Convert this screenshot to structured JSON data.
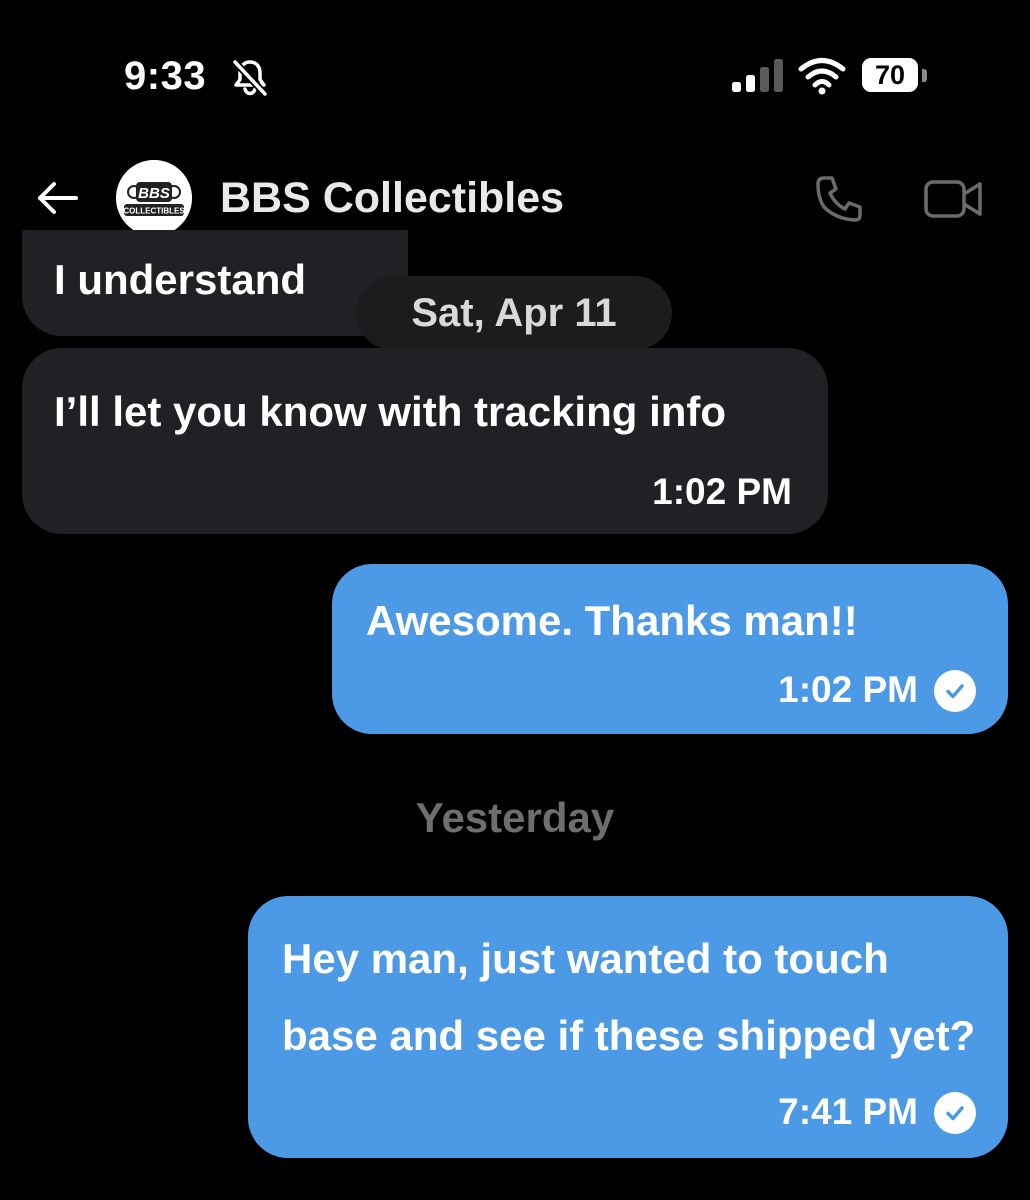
{
  "status_bar": {
    "time": "9:33",
    "battery": "70",
    "icons": [
      "bell-slash-icon",
      "signal-icon",
      "wifi-icon",
      "battery-icon"
    ]
  },
  "header": {
    "contact_name": "BBS Collectibles",
    "avatar": {
      "line1": "BBS",
      "line2": "COLLECTIBLES"
    },
    "icons": [
      "back-arrow-icon",
      "phone-icon",
      "video-icon"
    ]
  },
  "messages": [
    {
      "direction": "incoming",
      "text": "I understand"
    },
    {
      "direction": "incoming",
      "text": "I’ll let you know with tracking info",
      "time": "1:02 PM"
    },
    {
      "direction": "outgoing",
      "text": "Awesome. Thanks man!!",
      "time": "1:02 PM",
      "status": "sent"
    },
    {
      "direction": "outgoing",
      "text": "Hey man, just wanted to touch base and see if these shipped yet?",
      "time": "7:41 PM",
      "status": "sent"
    }
  ],
  "dividers": {
    "date_pill": "Sat, Apr 11",
    "yesterday": "Yesterday"
  },
  "colors": {
    "background": "#000000",
    "incoming_bubble": "#202124",
    "outgoing_bubble": "#4c99e6",
    "muted_text": "#6e6e6e"
  }
}
